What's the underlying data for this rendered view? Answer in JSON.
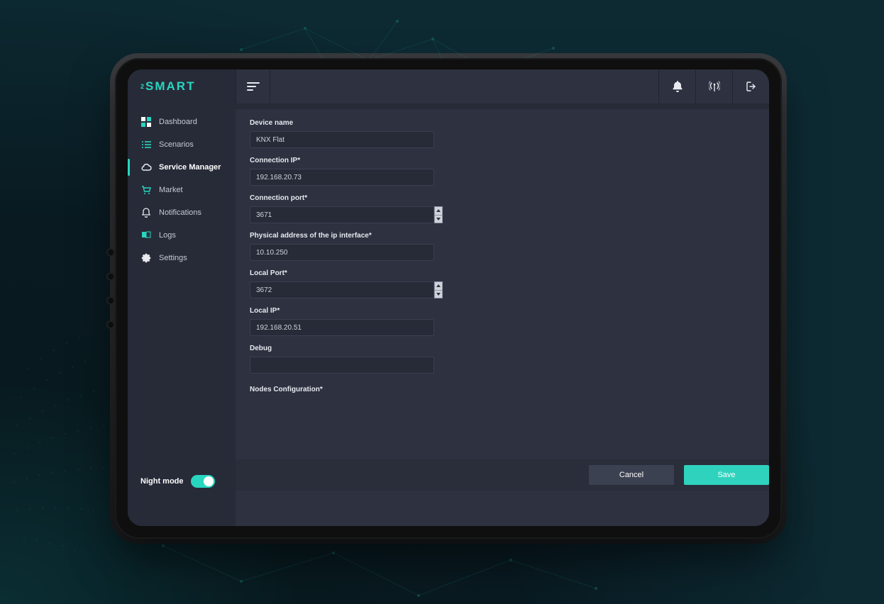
{
  "brand": {
    "prefix": "2",
    "name": "SMART"
  },
  "sidebar": {
    "items": [
      {
        "label": "Dashboard"
      },
      {
        "label": "Scenarios"
      },
      {
        "label": "Service Manager"
      },
      {
        "label": "Market"
      },
      {
        "label": "Notifications"
      },
      {
        "label": "Logs"
      },
      {
        "label": "Settings"
      }
    ],
    "night_mode_label": "Night mode",
    "night_mode_on": true
  },
  "form": {
    "device_name": {
      "label": "Device name",
      "value": "KNX Flat"
    },
    "connection_ip": {
      "label": "Connection IP*",
      "value": "192.168.20.73"
    },
    "connection_port": {
      "label": "Connection port*",
      "value": "3671"
    },
    "physical_address": {
      "label": "Physical address of the ip interface*",
      "value": "10.10.250"
    },
    "local_port": {
      "label": "Local Port*",
      "value": "3672"
    },
    "local_ip": {
      "label": "Local IP*",
      "value": "192.168.20.51"
    },
    "debug": {
      "label": "Debug",
      "value": ""
    },
    "nodes_configuration": {
      "label": "Nodes Configuration*"
    }
  },
  "actions": {
    "cancel": "Cancel",
    "save": "Save"
  },
  "colors": {
    "accent": "#28d6c0",
    "panel": "#2d3140",
    "app": "#272b38"
  }
}
